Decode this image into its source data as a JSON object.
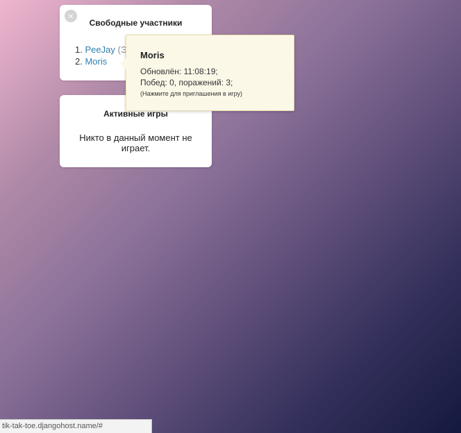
{
  "free_panel": {
    "close_icon": "×",
    "title": "Свободные участники",
    "players": [
      {
        "num": "1.",
        "name": "PeeJay",
        "extra": "(Э"
      },
      {
        "num": "2.",
        "name": "Moris",
        "extra": ""
      }
    ]
  },
  "games_panel": {
    "title": "Активные игры",
    "empty_text": "Никто в данный момент не играет."
  },
  "tooltip": {
    "name": "Moris",
    "updated": "Обновлён: 11:08:19;",
    "stats": "Побед: 0, поражений: 3;",
    "hint": "(Нажмите для приглашения в игру)"
  },
  "status_bar": {
    "url": "tik-tak-toe.djangohost.name/#"
  }
}
